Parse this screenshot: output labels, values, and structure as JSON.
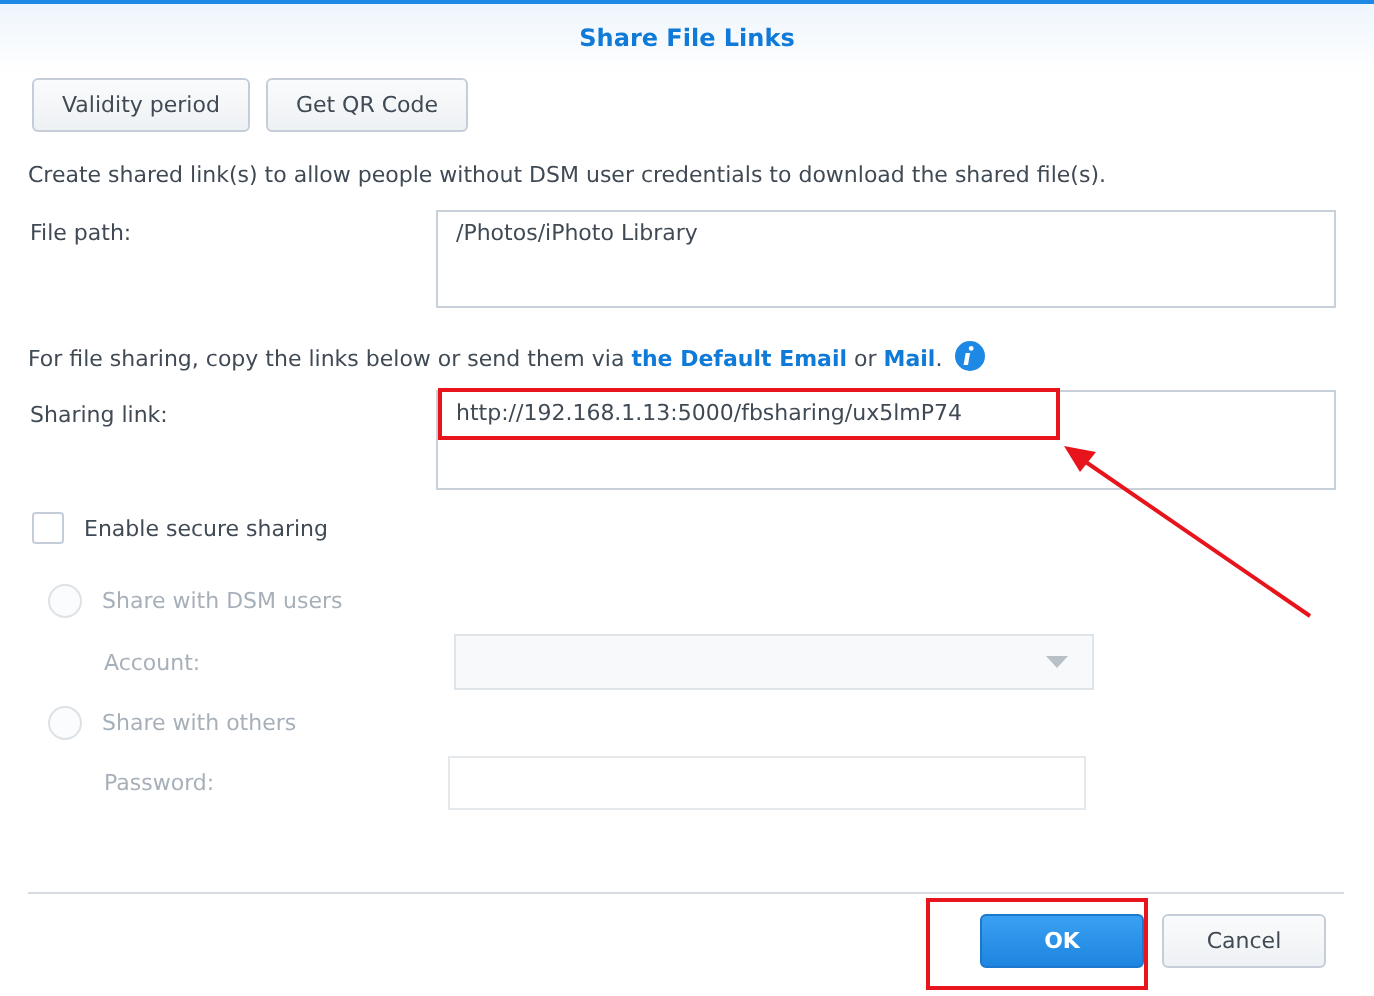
{
  "dialog": {
    "title": "Share File Links"
  },
  "toolbar_buttons": [
    {
      "label": "Validity period"
    },
    {
      "label": "Get QR Code"
    }
  ],
  "description": "Create shared link(s) to allow people without DSM user credentials to download the shared file(s).",
  "file_path": {
    "label": "File path:",
    "value": "/Photos/iPhoto Library"
  },
  "share_note": {
    "before": "For file sharing, copy the links below or send them via",
    "link_1": "the Default Email",
    "middle": "or",
    "link_2": "Mail",
    "after": "."
  },
  "sharing_link": {
    "label": "Sharing link:",
    "value": "http://192.168.1.13:5000/fbsharing/ux5lmP74"
  },
  "secure_sharing": {
    "label": "Enable secure sharing",
    "checked": false
  },
  "share_options": [
    {
      "label": "Share with DSM users",
      "selected": false,
      "disabled": true,
      "field": {
        "label": "Account:",
        "kind": "dropdown"
      }
    },
    {
      "label": "Share with others",
      "selected": false,
      "disabled": true,
      "field": {
        "label": "Password:",
        "kind": "password"
      }
    }
  ],
  "footer_buttons": [
    {
      "label": "OK",
      "kind": "primary"
    },
    {
      "label": "Cancel",
      "kind": "secondary"
    }
  ]
}
